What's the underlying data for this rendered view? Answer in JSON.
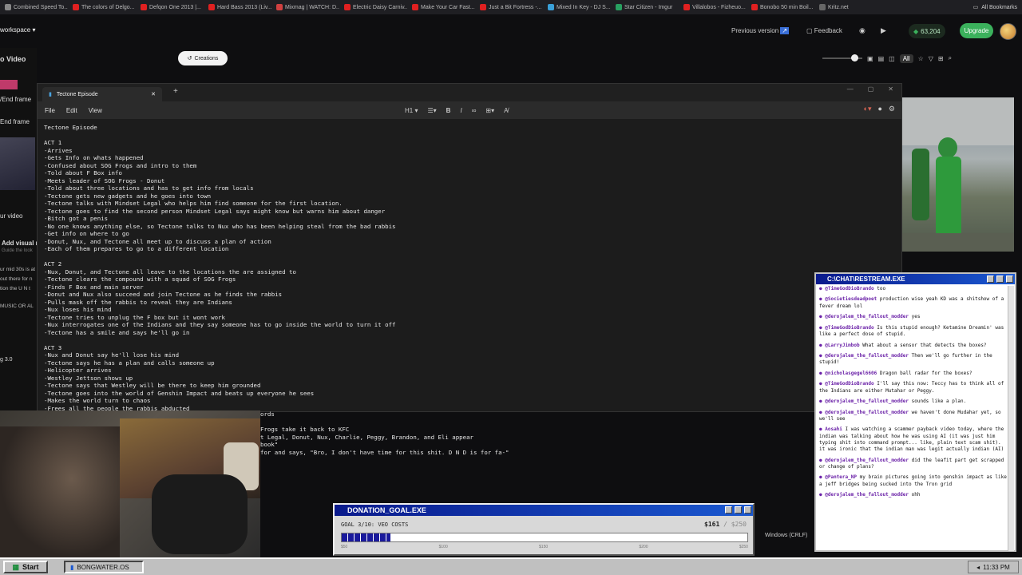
{
  "bookmarks": [
    {
      "label": "Combined Speed To...",
      "color": "#888"
    },
    {
      "label": "The colors of Delgo...",
      "color": "#e02020"
    },
    {
      "label": "Defqon One 2013 |...",
      "color": "#e02020"
    },
    {
      "label": "Hard Bass 2013 (Liv...",
      "color": "#e02020"
    },
    {
      "label": "Mixmag | WATCH: D...",
      "color": "#d04040"
    },
    {
      "label": "Electric Daisy Carniv...",
      "color": "#e02020"
    },
    {
      "label": "Make Your Car Fast...",
      "color": "#e02020"
    },
    {
      "label": "Just a Bit Fortress -...",
      "color": "#e02020"
    },
    {
      "label": "Mixed In Key - DJ S...",
      "color": "#3aa0d8"
    },
    {
      "label": "Star Citizen - Imgur",
      "color": "#28a060"
    },
    {
      "label": "Villalobos - Fizheuo...",
      "color": "#e02020"
    },
    {
      "label": "Bonobo 50 min Boil...",
      "color": "#e02020"
    },
    {
      "label": "Kritz.net",
      "color": "#666"
    }
  ],
  "bookmarks_all": "All Bookmarks",
  "workspace": "workspace",
  "previous_version": "Previous version",
  "feedback": "Feedback",
  "credits": "63,204",
  "upgrade": "Upgrade",
  "left_panel": [
    "o Video",
    "/End frame",
    "End frame",
    "ur video",
    "Add visual re",
    "Guide the look",
    "ur mid 30s is at",
    "out there for n",
    "tion the U N t",
    "MUSIC OR AL",
    "g 3.0"
  ],
  "creations": "Creations",
  "toolbar_right": {
    "all": "All"
  },
  "notepad": {
    "tab_title": "Tectone Episode",
    "menu": [
      "File",
      "Edit",
      "View"
    ],
    "heading": "H1",
    "lines": [
      "Tectone Episode",
      "",
      "ACT 1",
      "-Arrives",
      "-Gets Info on whats happened",
      "-Confused about SOG Frogs and intro to them",
      "-Told about F Box info",
      "-Meets leader of SOG Frogs - Donut",
      "-Told about three locations and has to get info from locals",
      "-Tectone gets new gadgets and he goes into town",
      "-Tectone talks with Mindset Legal who helps him find someone for the first location.",
      "-Tectone goes to find the second person Mindset Legal says might know but warns him about danger",
      "-Bitch got a penis",
      "-No one knows anything else, so Tectone talks to Nux who has been helping steal from the bad rabbis",
      "-Get info on where to go",
      "-Donut, Nux, and Tectone all meet up to discuss a plan of action",
      "-Each of them prepares to go to a different location",
      "",
      "ACT 2",
      "-Nux, Donut, and Tectone all leave to the locations the are assigned to",
      "-Tectone clears the compound with a squad of SOG Frogs",
      "-Finds F Box and main server",
      "-Donut and Nux also succeed and join Tectone as he finds the rabbis",
      "-Pulls mask off the rabbis to reveal they are Indians",
      "-Nux loses his mind",
      "-Tectone tries to unplug the F box but it wont work",
      "-Nux interrogates one of the Indians and they say someone has to go inside the world to turn it off",
      "-Tectone has a smile and says he'll go in",
      "",
      "ACT 3",
      "-Nux and Donut say he'll lose his mind",
      "-Tectone says he has a plan and calls someone up",
      "-Helicopter arrives",
      "-Westley Jettson shows up",
      "-Tectone says that Westley will be there to keep him grounded",
      "-Tectone goes into the world of Genshin Impact and beats up everyone he sees",
      "-Makes the world turn to chaos",
      "-Frees all the people the rabbis abducted"
    ],
    "lines_behind_cam": [
      "ords",
      "",
      "Frogs take it back to KFC",
      "t Legal, Donut, Nux, Charlie, Peggy, Brandon, and Eli appear",
      "book\"",
      "for and says, \"Bro, I don't have time for this shit. D N D is for fa-\""
    ]
  },
  "chat": {
    "title": "C:\\CHAT\\RESTREAM.EXE",
    "messages": [
      {
        "user": "@TimeGodDioBrando",
        "text": "too"
      },
      {
        "user": "@Societiesdeadpoet",
        "text": "production wise yeah KD was a shitshow of a fever dream lol"
      },
      {
        "user": "@derojalem_the_fallout_modder",
        "text": "yes"
      },
      {
        "user": "@TimeGodDioBrando",
        "text": "Is this stupid enough? Ketamine Dreamin' was like a perfect dose of stupid."
      },
      {
        "user": "@LarryJimbob",
        "text": "What about a sensor that detects the boxes?"
      },
      {
        "user": "@derojalem_the_fallout_modder",
        "text": "Then we'll go further in the stupid!"
      },
      {
        "user": "@nicholasgegel6606",
        "text": "Dragon ball radar for the boxes?"
      },
      {
        "user": "@TimeGodDioBrando",
        "text": "I'll say this now: Teccy has to think all of the Indians are either Mutahar or Peggy."
      },
      {
        "user": "@derojalem_the_fallout_modder",
        "text": "sounds like a plan."
      },
      {
        "user": "@derojalem_the_fallout_modder",
        "text": "we haven't done Mudahar yet, so we'll see"
      },
      {
        "user": "Aosahi",
        "text": "I was watching a scammer payback video today, where the indian was talking about how he was using AI (it was just him typing shit into command prompt... like, plain text scam shit). it was ironic that the indian man was legit actually indian (AI)"
      },
      {
        "user": "@derojalem_the_fallout_modder",
        "text": "did the leafit part get scrapped or change of plans?"
      },
      {
        "user": "@Pantera_NP",
        "text": "my brain pictures going into genshin impact as like a jeff bridges being sucked into the Tron grid"
      },
      {
        "user": "@derojalem_the_fallout_modder",
        "text": "ohh"
      }
    ]
  },
  "donation": {
    "title": "DONATION_GOAL.EXE",
    "goal": "GOAL 3/10: VEO COSTS",
    "amount": "$161",
    "target": "/ $250",
    "progress": 0.12,
    "ticks": [
      "$50",
      "$100",
      "$150",
      "$200",
      "$250"
    ]
  },
  "taskbar": {
    "start": "Start",
    "app": "BONGWATER.OS",
    "clock": "11:33 PM"
  },
  "windows_label": "Windows (CRLF)"
}
